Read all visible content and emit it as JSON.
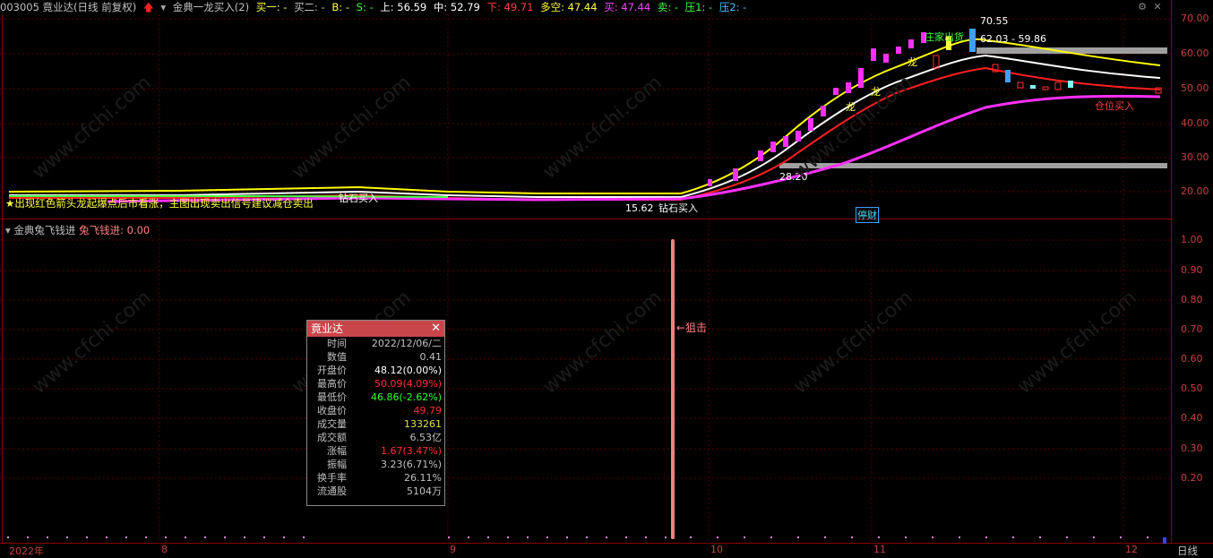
{
  "header": {
    "stock_code_name": "003005 竟业达(日线 前复权)",
    "indicator_name": "金典一龙买入(2)",
    "buy1": "买一: -",
    "buy2": "买二: -",
    "b": "B: -",
    "s": "S: -",
    "upper": "上: 56.59",
    "middle": "中: 52.79",
    "lower": "下: 49.71",
    "long_short": "多空: 47.44",
    "buy": "买: 47.44",
    "sell": "卖: -",
    "press1": "压1: -",
    "press2": "压2: -"
  },
  "main_chart": {
    "price_ticks": [
      "70.00",
      "60.00",
      "50.00",
      "40.00",
      "30.00",
      "20.00"
    ],
    "annotations": {
      "high_price": "70.55",
      "mid_level": "62.03 - 59.86",
      "low_price": "28.20",
      "bottom_low": "15.62",
      "signal_zhuangjia": "庄家出货",
      "signal_position_buy": "仓位买入",
      "signal_diamond_buy": "钻石买入",
      "signal_diamond_buy_2": "钻石买入",
      "signal_stop": "停财",
      "note_text": "出现红色箭头龙起爆点后市看涨，主图出现卖出信号建议减仓卖出",
      "dragon": "龙"
    },
    "colors": {
      "yellow_line": "#ffff00",
      "white_line": "#ffffff",
      "red_line": "#ff2020",
      "magenta_line": "#ff30ff",
      "gray_band": "#a0a0a0"
    }
  },
  "sub_chart": {
    "indicator_name": "金典兔飞钱进",
    "indicator_value": "兔飞钱进: 0.00",
    "ticks": [
      "1.00",
      "0.90",
      "0.80",
      "0.70",
      "0.60",
      "0.50",
      "0.40",
      "0.30",
      "0.20"
    ],
    "signal_label": "←狙击"
  },
  "x_axis": {
    "labels": [
      "2022年",
      "8",
      "9",
      "10",
      "11",
      "12"
    ],
    "period": "日线"
  },
  "popup": {
    "title": "竟业达",
    "rows": [
      {
        "k": "时间",
        "v": "2022/12/06/二",
        "color": "#c0c0c0"
      },
      {
        "k": "数值",
        "v": "0.41",
        "color": "#c0c0c0"
      },
      {
        "k": "开盘价",
        "v": "48.12(0.00%)",
        "color": "#ffffff"
      },
      {
        "k": "最高价",
        "v": "50.09(4.09%)",
        "color": "#ff3030"
      },
      {
        "k": "最低价",
        "v": "46.86(-2.62%)",
        "color": "#30ff30"
      },
      {
        "k": "收盘价",
        "v": "49.79",
        "color": "#ff3030"
      },
      {
        "k": "成交量",
        "v": "133261",
        "color": "#e0e040"
      },
      {
        "k": "成交额",
        "v": "6.53亿",
        "color": "#c0c0c0"
      },
      {
        "k": "涨幅",
        "v": "1.67(3.47%)",
        "color": "#ff3030"
      },
      {
        "k": "振幅",
        "v": "3.23(6.71%)",
        "color": "#c0c0c0"
      },
      {
        "k": "换手率",
        "v": "26.11%",
        "color": "#c0c0c0"
      },
      {
        "k": "流通股",
        "v": "5104万",
        "color": "#c0c0c0"
      }
    ]
  },
  "watermark": "www.cfchi.com"
}
